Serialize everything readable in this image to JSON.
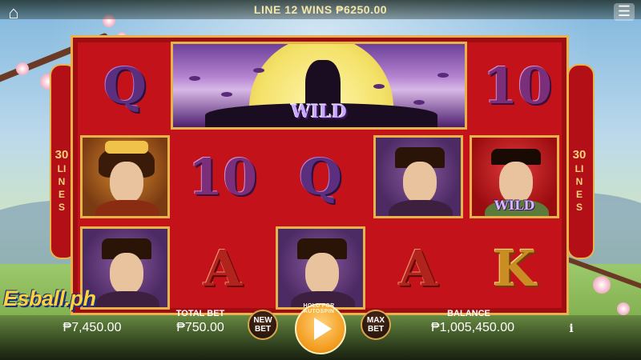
{
  "top": {
    "win_message": "LINE 12 WINS ₱6250.00",
    "home_icon": "⌂",
    "menu_icon": "☰"
  },
  "side": {
    "left": {
      "lines_number": "30",
      "lines_word": "LINES"
    },
    "right": {
      "lines_number": "30",
      "lines_word": "LINES"
    }
  },
  "reels": {
    "row1": [
      {
        "type": "card",
        "label": "Q"
      },
      {
        "type": "wild_banner",
        "label": "WILD"
      },
      {
        "type": "card",
        "label": "10"
      }
    ],
    "row2": [
      {
        "type": "symbol",
        "name": "lady"
      },
      {
        "type": "card",
        "label": "10"
      },
      {
        "type": "card",
        "label": "Q"
      },
      {
        "type": "symbol",
        "name": "warrior"
      },
      {
        "type": "symbol",
        "name": "scholar",
        "wild_label": "WILD"
      }
    ],
    "row3": [
      {
        "type": "symbol",
        "name": "warrior"
      },
      {
        "type": "card",
        "label": "A"
      },
      {
        "type": "symbol",
        "name": "warrior"
      },
      {
        "type": "card",
        "label": "A"
      },
      {
        "type": "card",
        "label": "K"
      }
    ]
  },
  "bottom": {
    "logo_text": "Esball.ph",
    "credit_value": "₱7,450.00",
    "total_bet_label": "TOTAL BET",
    "total_bet_value": "₱750.00",
    "new_bet_line1": "NEW",
    "new_bet_line2": "BET",
    "spin_hint": "HOLD FOR AUTOSPIN",
    "max_bet_line1": "MAX",
    "max_bet_line2": "BET",
    "balance_label": "BALANCE",
    "balance_value": "₱1,005,450.00",
    "info_icon": "i"
  },
  "colors": {
    "frame_red": "#c3121a",
    "gold_border": "#e6b44b",
    "spin_orange": "#f29a1c"
  }
}
